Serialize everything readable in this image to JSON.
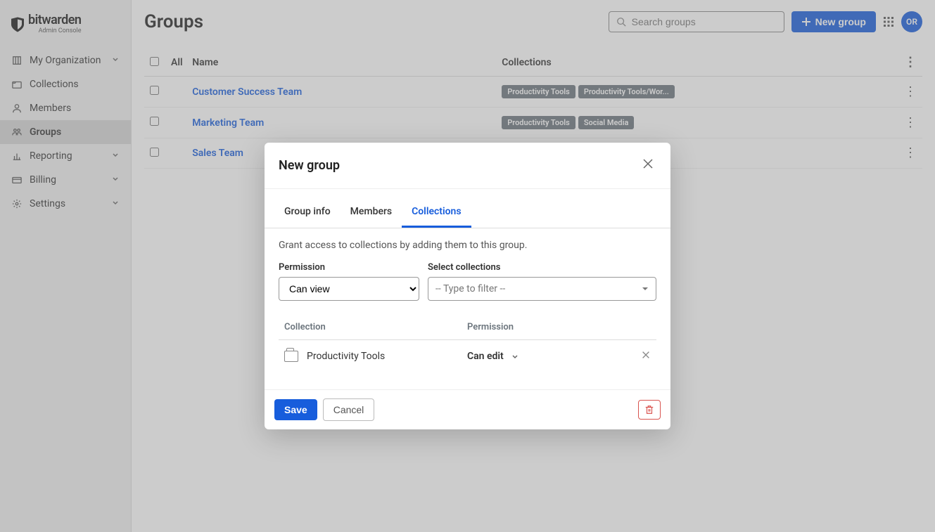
{
  "brand": {
    "name": "bitwarden",
    "subtitle": "Admin Console"
  },
  "sidebar": {
    "items": [
      {
        "label": "My Organization",
        "expandable": true,
        "icon": "org"
      },
      {
        "label": "Collections",
        "expandable": false,
        "icon": "collection"
      },
      {
        "label": "Members",
        "expandable": false,
        "icon": "user"
      },
      {
        "label": "Groups",
        "expandable": false,
        "icon": "group",
        "active": true
      },
      {
        "label": "Reporting",
        "expandable": true,
        "icon": "report"
      },
      {
        "label": "Billing",
        "expandable": true,
        "icon": "billing"
      },
      {
        "label": "Settings",
        "expandable": true,
        "icon": "gear"
      }
    ]
  },
  "header": {
    "title": "Groups",
    "search_placeholder": "Search groups",
    "new_button": "New group",
    "avatar_initials": "OR"
  },
  "table": {
    "col_all": "All",
    "col_name": "Name",
    "col_collections": "Collections",
    "rows": [
      {
        "name": "Customer Success Team",
        "badges": [
          "Productivity Tools",
          "Productivity Tools/Wor..."
        ]
      },
      {
        "name": "Marketing Team",
        "badges": [
          "Productivity Tools",
          "Social Media"
        ]
      },
      {
        "name": "Sales Team",
        "badges": []
      }
    ]
  },
  "modal": {
    "title": "New group",
    "tabs": [
      "Group info",
      "Members",
      "Collections"
    ],
    "active_tab": "Collections",
    "help_text": "Grant access to collections by adding them to this group.",
    "permission_label": "Permission",
    "permission_value": "Can view",
    "select_label": "Select collections",
    "filter_placeholder": "-- Type to filter --",
    "coll_col_collection": "Collection",
    "coll_col_permission": "Permission",
    "coll_rows": [
      {
        "name": "Productivity Tools",
        "permission": "Can edit"
      }
    ],
    "save": "Save",
    "cancel": "Cancel"
  }
}
